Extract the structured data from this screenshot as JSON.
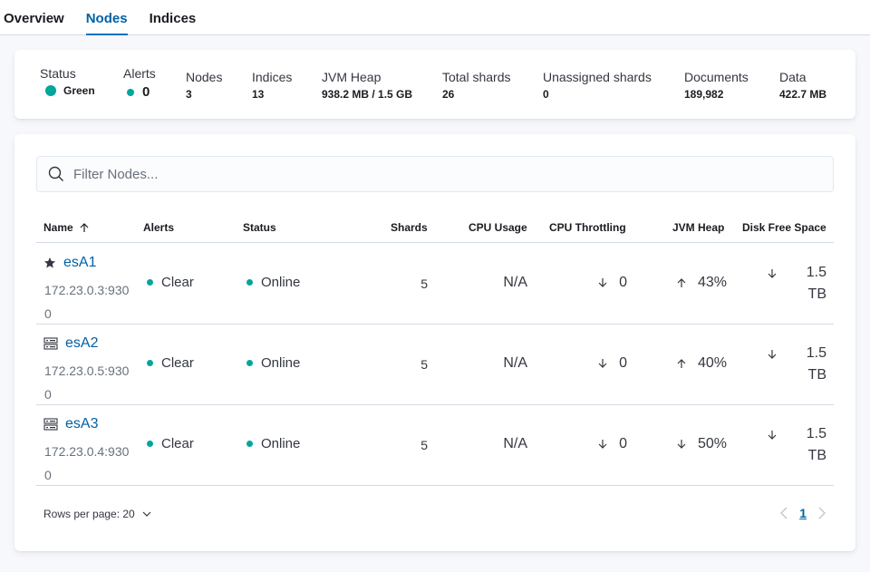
{
  "tabs": [
    {
      "label": "Overview"
    },
    {
      "label": "Nodes"
    },
    {
      "label": "Indices"
    }
  ],
  "summary": {
    "status": {
      "label": "Status",
      "value": "Green"
    },
    "alerts": {
      "label": "Alerts",
      "value": "0"
    },
    "nodes": {
      "label": "Nodes",
      "value": "3"
    },
    "indices": {
      "label": "Indices",
      "value": "13"
    },
    "jvm_heap": {
      "label": "JVM Heap",
      "value": "938.2 MB / 1.5 GB"
    },
    "total_shards": {
      "label": "Total shards",
      "value": "26"
    },
    "unassigned_shards": {
      "label": "Unassigned shards",
      "value": "0"
    },
    "documents": {
      "label": "Documents",
      "value": "189,982"
    },
    "data": {
      "label": "Data",
      "value": "422.7 MB"
    }
  },
  "search": {
    "placeholder": "Filter Nodes..."
  },
  "table": {
    "headers": {
      "name": "Name",
      "alerts": "Alerts",
      "status": "Status",
      "shards": "Shards",
      "cpu_usage": "CPU Usage",
      "cpu_throttling": "CPU Throttling",
      "jvm_heap": "JVM Heap",
      "disk_free": "Disk Free Space"
    },
    "rows": [
      {
        "icon": "star-icon",
        "name": "esA1",
        "address": "172.23.0.3:9300",
        "alerts": "Clear",
        "status": "Online",
        "shards": "5",
        "cpu_usage": "N/A",
        "cpu_throttling": "0",
        "cpu_throttling_trend": "down",
        "jvm_heap": "43%",
        "jvm_heap_trend": "up",
        "disk_free_line1": "1.5",
        "disk_free_line2": "TB",
        "disk_trend": "down"
      },
      {
        "icon": "server-icon",
        "name": "esA2",
        "address": "172.23.0.5:9300",
        "alerts": "Clear",
        "status": "Online",
        "shards": "5",
        "cpu_usage": "N/A",
        "cpu_throttling": "0",
        "cpu_throttling_trend": "down",
        "jvm_heap": "40%",
        "jvm_heap_trend": "up",
        "disk_free_line1": "1.5",
        "disk_free_line2": "TB",
        "disk_trend": "down"
      },
      {
        "icon": "server-icon",
        "name": "esA3",
        "address": "172.23.0.4:9300",
        "alerts": "Clear",
        "status": "Online",
        "shards": "5",
        "cpu_usage": "N/A",
        "cpu_throttling": "0",
        "cpu_throttling_trend": "down",
        "jvm_heap": "50%",
        "jvm_heap_trend": "down",
        "disk_free_line1": "1.5",
        "disk_free_line2": "TB",
        "disk_trend": "down"
      }
    ]
  },
  "pagination": {
    "rows_per_page": "Rows per page: 20",
    "current_page": "1"
  },
  "colors": {
    "accent": "#0061a6",
    "status_green": "#00a69b",
    "border": "#d3dae6"
  }
}
